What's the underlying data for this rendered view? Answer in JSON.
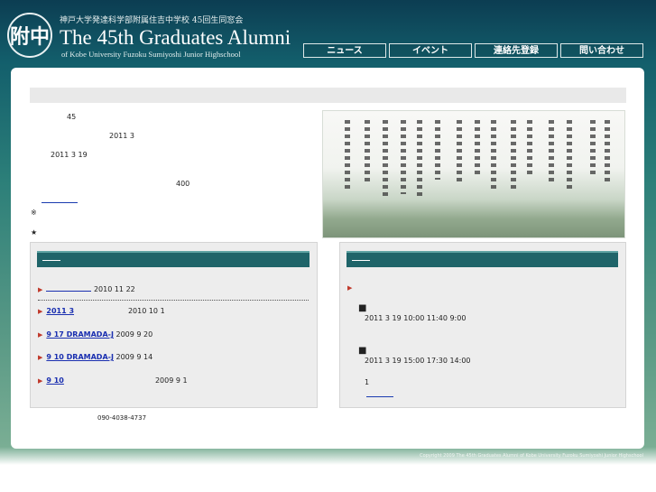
{
  "header": {
    "logo_text": "附中",
    "school_line": "神戸大学発達科学部附属住吉中学校 45回生同窓会",
    "title": "The 45th Graduates Alumni",
    "subtitle": "of Kobe University Fuzoku Sumiyoshi Junior Highschool"
  },
  "nav": [
    {
      "label": "ニュース"
    },
    {
      "label": "イベント"
    },
    {
      "label": "連絡先登録"
    },
    {
      "label": "問い合わせ"
    }
  ],
  "intro": {
    "line1": "45",
    "line2": "2011 3",
    "line3": "2011 3 19",
    "line4": "400",
    "note_mark": "※",
    "star_mark": "★"
  },
  "news": {
    "items": [
      {
        "link": "",
        "date": "2010 11 22"
      },
      {
        "link": "2011  3",
        "date": "2010 10  1"
      },
      {
        "link": "9  17    DRAMADA-J",
        "date": "2009 9 20"
      },
      {
        "link": "9  10  DRAMADA-J",
        "date": "2009 9 14"
      },
      {
        "link": "9  10",
        "date": "2009 9  1"
      }
    ]
  },
  "event": {
    "marker": "■",
    "session1": "2011 3 19    10:00 11:40    9:00",
    "session2": "2011 3 19    15:00 17:30    14:00",
    "note": "1"
  },
  "contact": {
    "tel": "090-4038-4737"
  },
  "footer": {
    "copyright": "Copyright 2009 The 45th Graduates Alumni of Kobe University Fuzoku Sumiyoshi Junior Highschool"
  },
  "colors": {
    "header_dark": "#0c3d52",
    "box_head": "#1f6469",
    "link": "#1a2fb0",
    "bullet": "#c0392b"
  }
}
